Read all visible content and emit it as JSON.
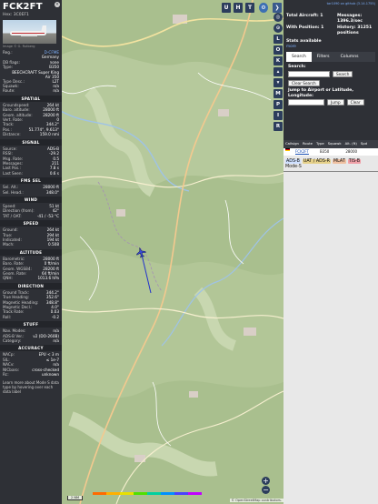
{
  "info_panel": {
    "callsign": "FCK2FT",
    "hex_label": "Hex:",
    "hex": "3C0EF1",
    "close_icon": "×",
    "photo_credit": "Image © G. Rutberg",
    "fields_top": [
      {
        "k": "Reg.:",
        "v": "D-CFME",
        "link": true
      },
      {
        "k": "",
        "v": "Germany"
      },
      {
        "k": "DB flags:",
        "v": "none"
      },
      {
        "k": "Type:",
        "v": "B350"
      }
    ],
    "type_full_line1": "BEECHCRAFT Super King",
    "type_full_line2": "Air 350",
    "fields_mid": [
      {
        "k": "Type Desc.:",
        "v": "L2T"
      },
      {
        "k": "Squawk:",
        "v": "n/a"
      },
      {
        "k": "Route:",
        "v": "n/a"
      }
    ],
    "sections": [
      {
        "title": "SPATIAL",
        "rows": [
          {
            "k": "Groundspeed:",
            "v": "264 kt"
          },
          {
            "k": "Baro. altitude:",
            "v": "28000 ft"
          },
          {
            "k": "Geom. altitude:",
            "v": "28200 ft"
          },
          {
            "k": "Vert. Rate:",
            "v": "0"
          },
          {
            "k": "Track:",
            "v": "344.2°"
          },
          {
            "k": "Pos.:",
            "v": "51.774°, 9.613°"
          },
          {
            "k": "Distance:",
            "v": "159.0 nmi"
          }
        ]
      },
      {
        "title": "SIGNAL",
        "rows": [
          {
            "k": "Source:",
            "v": "ADS-B"
          },
          {
            "k": "RSSI:",
            "v": "-29.2"
          },
          {
            "k": "Msg. Rate:",
            "v": "0.5"
          },
          {
            "k": "Messages:",
            "v": "211"
          },
          {
            "k": "Last Pos.:",
            "v": "7.8 s"
          },
          {
            "k": "Last Seen:",
            "v": "0.6 s"
          }
        ]
      },
      {
        "title": "FMS SEL",
        "rows": [
          {
            "k": "Sel. Alt.:",
            "v": "28000 ft"
          },
          {
            "k": "Sel. Head.:",
            "v": "348.0°"
          }
        ]
      },
      {
        "title": "WIND",
        "rows": [
          {
            "k": "Speed:",
            "v": "51 kt"
          },
          {
            "k": "Direction (from):",
            "v": "42°"
          },
          {
            "k": "TAT / OAT:",
            "v": "-41 / -53 °C"
          }
        ]
      },
      {
        "title": "SPEED",
        "rows": [
          {
            "k": "Ground:",
            "v": "264 kt"
          },
          {
            "k": "True:",
            "v": "294 kt"
          },
          {
            "k": "Indicated:",
            "v": "194 kt"
          },
          {
            "k": "Mach:",
            "v": "0.508"
          }
        ]
      },
      {
        "title": "ALTITUDE",
        "rows": [
          {
            "k": "Barometric:",
            "v": "28000 ft"
          },
          {
            "k": "Baro. Rate:",
            "v": "0 ft/min"
          },
          {
            "k": "Geom. WGS84:",
            "v": "28200 ft"
          },
          {
            "k": "Geom. Rate:",
            "v": "64 ft/min"
          },
          {
            "k": "QNH:",
            "v": "1013.6 hPa"
          }
        ]
      },
      {
        "title": "DIRECTION",
        "rows": [
          {
            "k": "Ground Track:",
            "v": "344.2°"
          },
          {
            "k": "True Heading:",
            "v": "352.6°"
          },
          {
            "k": "Magnetic Heading:",
            "v": "348.8°"
          },
          {
            "k": "Magnetic Decl.:",
            "v": "4.0°"
          },
          {
            "k": "Track Rate:",
            "v": "0.03"
          },
          {
            "k": "Roll:",
            "v": "-0.2"
          }
        ]
      },
      {
        "title": "STUFF",
        "rows": [
          {
            "k": "Nav. Modes:",
            "v": "n/a"
          },
          {
            "k": "ADS-B Ver.:",
            "v": "v2 (DO-260B)"
          },
          {
            "k": "Category:",
            "v": "n/a"
          }
        ]
      },
      {
        "title": "ACCURACY",
        "rows": [
          {
            "k": "NACp:",
            "v": "EPU < 3 m"
          },
          {
            "k": "SIL:",
            "v": "≤ 1e-7"
          },
          {
            "k": "NACv:",
            "v": "n/a"
          },
          {
            "k": "NICbaro:",
            "v": "cross-checked"
          },
          {
            "k": "Rc:",
            "v": "unknown"
          }
        ]
      }
    ],
    "footer_text": "Learn more about Mode S data type by hovering over each data label"
  },
  "map": {
    "top_buttons": [
      "U",
      "H",
      "T"
    ],
    "side_buttons": [
      "L",
      "O",
      "K",
      "M",
      "P",
      "I",
      "R"
    ],
    "zoom_in": "+",
    "zoom_out": "−",
    "scale": "2 NM",
    "altitude_legend": [
      "",
      "",
      "",
      "",
      "",
      "",
      ""
    ],
    "attribution": "© OpenStreetMap contributors."
  },
  "right_panel": {
    "top_link": "tar1090 on github (3.14.1755)",
    "stats": [
      {
        "l": "Total Aircraft: 1",
        "r": "Messages: 1396.3/sec"
      },
      {
        "l": "With Position: 1",
        "r": "History: 31251 positions"
      }
    ],
    "stats_available": "Stats available",
    "stats_more": "more",
    "tabs": [
      "Search",
      "Filters",
      "Columns"
    ],
    "search_label": "Search:",
    "search_button": "Search",
    "clear_search_button": "Clear Search",
    "jump_label": "Jump to Airport or Latitude, Longitude:",
    "jump_button": "Jump",
    "clear_button": "Clear",
    "table_columns": [
      "Callsign",
      "Route",
      "Type",
      "Squawk",
      "Alt. (ft)",
      "Spd"
    ],
    "table_rows": [
      {
        "callsign": "FCK2FT",
        "route": "",
        "type": "B350",
        "squawk": "",
        "alt": "28000",
        "spd": ""
      }
    ],
    "sources": [
      {
        "label": "ADS-B",
        "color": "#cfe0ff"
      },
      {
        "label": "UAT / ADS-R",
        "color": "#e6d18a"
      },
      {
        "label": "MLAT",
        "color": "#f0c0a0"
      },
      {
        "label": "TIS-B",
        "color": "#f0a0a8"
      }
    ],
    "mode_s": "Mode-S"
  }
}
